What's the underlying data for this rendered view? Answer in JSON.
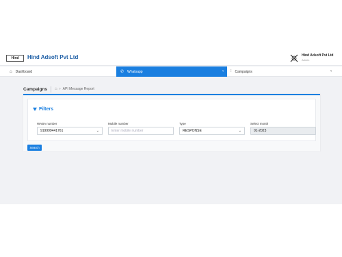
{
  "header": {
    "logo_text": "Hind",
    "brand_title": "Hind Adsoft Pvt Ltd",
    "user_name": "Hind Adsoft Pvt Ltd",
    "user_role": "Admin"
  },
  "nav": {
    "dashboard_label": "Dashboard",
    "whatsapp_label": "Whatsapp",
    "campaigns_label": "Campaigns"
  },
  "breadcrumb": {
    "title": "Campaigns",
    "page": "API Message Report"
  },
  "filters": {
    "heading": "Filters",
    "waba": {
      "label": "WABA number",
      "value": "919999441761"
    },
    "mobile": {
      "label": "Mobile number",
      "placeholder": "Enter mobile number"
    },
    "type": {
      "label": "Type",
      "value": "RESPONSE"
    },
    "month": {
      "label": "Select month",
      "value": "01-2023"
    },
    "search_label": "Search"
  },
  "colors": {
    "accent": "#1a7fe0",
    "brand": "#1e5fa6",
    "background": "#f1f2f5"
  }
}
